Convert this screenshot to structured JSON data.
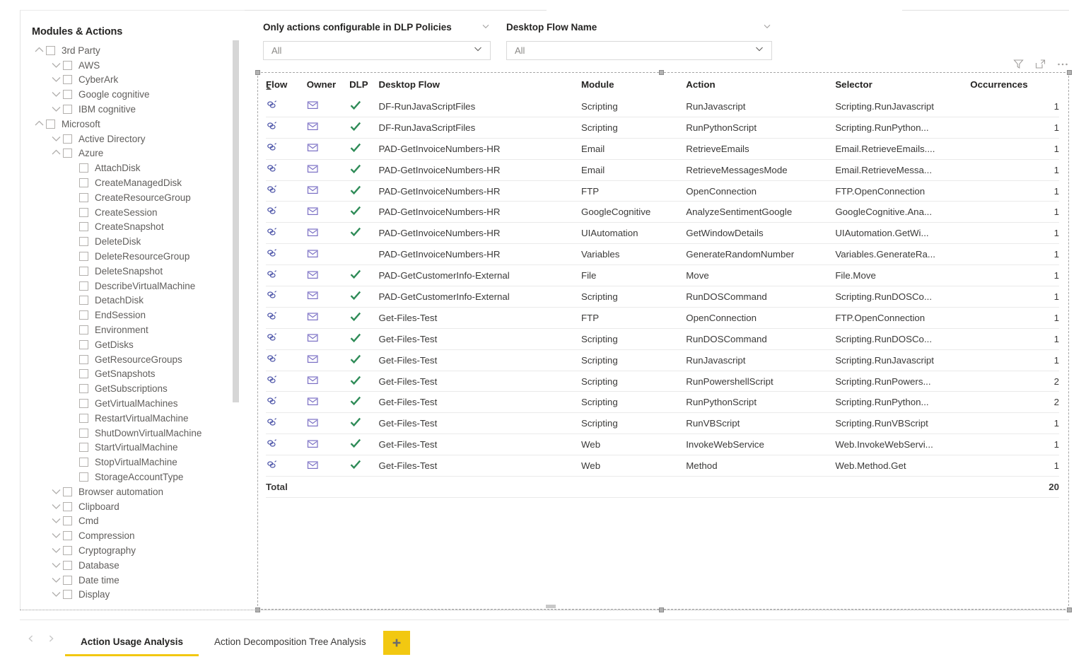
{
  "tree": {
    "title": "Modules & Actions",
    "items": [
      {
        "label": "3rd Party",
        "level": 0,
        "chevron": "up",
        "checkbox": true
      },
      {
        "label": "AWS",
        "level": 1,
        "chevron": "down",
        "checkbox": true
      },
      {
        "label": "CyberArk",
        "level": 1,
        "chevron": "down",
        "checkbox": true
      },
      {
        "label": "Google cognitive",
        "level": 1,
        "chevron": "down",
        "checkbox": true
      },
      {
        "label": "IBM cognitive",
        "level": 1,
        "chevron": "down",
        "checkbox": true
      },
      {
        "label": "Microsoft",
        "level": 0,
        "chevron": "up",
        "checkbox": true
      },
      {
        "label": "Active Directory",
        "level": 1,
        "chevron": "down",
        "checkbox": true
      },
      {
        "label": "Azure",
        "level": 1,
        "chevron": "up",
        "checkbox": true
      },
      {
        "label": "AttachDisk",
        "level": 2,
        "chevron": "none",
        "checkbox": true
      },
      {
        "label": "CreateManagedDisk",
        "level": 2,
        "chevron": "none",
        "checkbox": true
      },
      {
        "label": "CreateResourceGroup",
        "level": 2,
        "chevron": "none",
        "checkbox": true
      },
      {
        "label": "CreateSession",
        "level": 2,
        "chevron": "none",
        "checkbox": true
      },
      {
        "label": "CreateSnapshot",
        "level": 2,
        "chevron": "none",
        "checkbox": true
      },
      {
        "label": "DeleteDisk",
        "level": 2,
        "chevron": "none",
        "checkbox": true
      },
      {
        "label": "DeleteResourceGroup",
        "level": 2,
        "chevron": "none",
        "checkbox": true
      },
      {
        "label": "DeleteSnapshot",
        "level": 2,
        "chevron": "none",
        "checkbox": true
      },
      {
        "label": "DescribeVirtualMachine",
        "level": 2,
        "chevron": "none",
        "checkbox": true
      },
      {
        "label": "DetachDisk",
        "level": 2,
        "chevron": "none",
        "checkbox": true
      },
      {
        "label": "EndSession",
        "level": 2,
        "chevron": "none",
        "checkbox": true
      },
      {
        "label": "Environment",
        "level": 2,
        "chevron": "none",
        "checkbox": true
      },
      {
        "label": "GetDisks",
        "level": 2,
        "chevron": "none",
        "checkbox": true
      },
      {
        "label": "GetResourceGroups",
        "level": 2,
        "chevron": "none",
        "checkbox": true
      },
      {
        "label": "GetSnapshots",
        "level": 2,
        "chevron": "none",
        "checkbox": true
      },
      {
        "label": "GetSubscriptions",
        "level": 2,
        "chevron": "none",
        "checkbox": true
      },
      {
        "label": "GetVirtualMachines",
        "level": 2,
        "chevron": "none",
        "checkbox": true
      },
      {
        "label": "RestartVirtualMachine",
        "level": 2,
        "chevron": "none",
        "checkbox": true
      },
      {
        "label": "ShutDownVirtualMachine",
        "level": 2,
        "chevron": "none",
        "checkbox": true
      },
      {
        "label": "StartVirtualMachine",
        "level": 2,
        "chevron": "none",
        "checkbox": true
      },
      {
        "label": "StopVirtualMachine",
        "level": 2,
        "chevron": "none",
        "checkbox": true
      },
      {
        "label": "StorageAccountType",
        "level": 2,
        "chevron": "none",
        "checkbox": true
      },
      {
        "label": "Browser automation",
        "level": 1,
        "chevron": "down",
        "checkbox": true
      },
      {
        "label": "Clipboard",
        "level": 1,
        "chevron": "down",
        "checkbox": true
      },
      {
        "label": "Cmd",
        "level": 1,
        "chevron": "down",
        "checkbox": true
      },
      {
        "label": "Compression",
        "level": 1,
        "chevron": "down",
        "checkbox": true
      },
      {
        "label": "Cryptography",
        "level": 1,
        "chevron": "down",
        "checkbox": true
      },
      {
        "label": "Database",
        "level": 1,
        "chevron": "down",
        "checkbox": true
      },
      {
        "label": "Date time",
        "level": 1,
        "chevron": "down",
        "checkbox": true
      },
      {
        "label": "Display",
        "level": 1,
        "chevron": "down",
        "checkbox": true
      }
    ]
  },
  "slicers": [
    {
      "title": "Only actions configurable in DLP Policies",
      "value": "All"
    },
    {
      "title": "Desktop Flow Name",
      "value": "All"
    }
  ],
  "visual_header": {
    "filter_icon": "filter-icon",
    "focus_icon": "focus-mode-icon",
    "more_icon": "more-options-icon"
  },
  "table": {
    "columns": [
      "Flow",
      "Owner",
      "DLP",
      "Desktop Flow",
      "Module",
      "Action",
      "Selector",
      "Occurrences"
    ],
    "sorted_column": "Flow",
    "sort_direction": "asc",
    "icons": {
      "flow": "link-icon",
      "owner": "envelope-icon",
      "dlp": "checkmark-icon"
    },
    "rows": [
      {
        "flow": "link-icon",
        "owner": "envelope-icon",
        "dlp": true,
        "name": "DF-RunJavaScriptFiles",
        "module": "Scripting",
        "action": "RunJavascript",
        "selector": "Scripting.RunJavascript",
        "occurrences": "1"
      },
      {
        "flow": "link-icon",
        "owner": "envelope-icon",
        "dlp": true,
        "name": "DF-RunJavaScriptFiles",
        "module": "Scripting",
        "action": "RunPythonScript",
        "selector": "Scripting.RunPython...",
        "occurrences": "1"
      },
      {
        "flow": "link-icon",
        "owner": "envelope-icon",
        "dlp": true,
        "name": "PAD-GetInvoiceNumbers-HR",
        "module": "Email",
        "action": "RetrieveEmails",
        "selector": "Email.RetrieveEmails....",
        "occurrences": "1"
      },
      {
        "flow": "link-icon",
        "owner": "envelope-icon",
        "dlp": true,
        "name": "PAD-GetInvoiceNumbers-HR",
        "module": "Email",
        "action": "RetrieveMessagesMode",
        "selector": "Email.RetrieveMessa...",
        "occurrences": "1"
      },
      {
        "flow": "link-icon",
        "owner": "envelope-icon",
        "dlp": true,
        "name": "PAD-GetInvoiceNumbers-HR",
        "module": "FTP",
        "action": "OpenConnection",
        "selector": "FTP.OpenConnection",
        "occurrences": "1"
      },
      {
        "flow": "link-icon",
        "owner": "envelope-icon",
        "dlp": true,
        "name": "PAD-GetInvoiceNumbers-HR",
        "module": "GoogleCognitive",
        "action": "AnalyzeSentimentGoogle",
        "selector": "GoogleCognitive.Ana...",
        "occurrences": "1"
      },
      {
        "flow": "link-icon",
        "owner": "envelope-icon",
        "dlp": true,
        "name": "PAD-GetInvoiceNumbers-HR",
        "module": "UIAutomation",
        "action": "GetWindowDetails",
        "selector": "UIAutomation.GetWi...",
        "occurrences": "1"
      },
      {
        "flow": "link-icon",
        "owner": "envelope-icon",
        "dlp": false,
        "name": "PAD-GetInvoiceNumbers-HR",
        "module": "Variables",
        "action": "GenerateRandomNumber",
        "selector": "Variables.GenerateRa...",
        "occurrences": "1"
      },
      {
        "flow": "link-icon",
        "owner": "envelope-icon",
        "dlp": true,
        "name": "PAD-GetCustomerInfo-External",
        "module": "File",
        "action": "Move",
        "selector": "File.Move",
        "occurrences": "1"
      },
      {
        "flow": "link-icon",
        "owner": "envelope-icon",
        "dlp": true,
        "name": "PAD-GetCustomerInfo-External",
        "module": "Scripting",
        "action": "RunDOSCommand",
        "selector": "Scripting.RunDOSCo...",
        "occurrences": "1"
      },
      {
        "flow": "link-icon",
        "owner": "envelope-icon",
        "dlp": true,
        "name": "Get-Files-Test",
        "module": "FTP",
        "action": "OpenConnection",
        "selector": "FTP.OpenConnection",
        "occurrences": "1"
      },
      {
        "flow": "link-icon",
        "owner": "envelope-icon",
        "dlp": true,
        "name": "Get-Files-Test",
        "module": "Scripting",
        "action": "RunDOSCommand",
        "selector": "Scripting.RunDOSCo...",
        "occurrences": "1"
      },
      {
        "flow": "link-icon",
        "owner": "envelope-icon",
        "dlp": true,
        "name": "Get-Files-Test",
        "module": "Scripting",
        "action": "RunJavascript",
        "selector": "Scripting.RunJavascript",
        "occurrences": "1"
      },
      {
        "flow": "link-icon",
        "owner": "envelope-icon",
        "dlp": true,
        "name": "Get-Files-Test",
        "module": "Scripting",
        "action": "RunPowershellScript",
        "selector": "Scripting.RunPowers...",
        "occurrences": "2"
      },
      {
        "flow": "link-icon",
        "owner": "envelope-icon",
        "dlp": true,
        "name": "Get-Files-Test",
        "module": "Scripting",
        "action": "RunPythonScript",
        "selector": "Scripting.RunPython...",
        "occurrences": "2"
      },
      {
        "flow": "link-icon",
        "owner": "envelope-icon",
        "dlp": true,
        "name": "Get-Files-Test",
        "module": "Scripting",
        "action": "RunVBScript",
        "selector": "Scripting.RunVBScript",
        "occurrences": "1"
      },
      {
        "flow": "link-icon",
        "owner": "envelope-icon",
        "dlp": true,
        "name": "Get-Files-Test",
        "module": "Web",
        "action": "InvokeWebService",
        "selector": "Web.InvokeWebServi...",
        "occurrences": "1"
      },
      {
        "flow": "link-icon",
        "owner": "envelope-icon",
        "dlp": true,
        "name": "Get-Files-Test",
        "module": "Web",
        "action": "Method",
        "selector": "Web.Method.Get",
        "occurrences": "1"
      }
    ],
    "total": {
      "label": "Total",
      "occurrences": "20"
    }
  },
  "tabs": {
    "prev_icon": "chevron-left-icon",
    "next_icon": "chevron-right-icon",
    "items": [
      {
        "label": "Action Usage Analysis",
        "active": true
      },
      {
        "label": "Action Decomposition Tree Analysis",
        "active": false
      }
    ],
    "add_label": "+"
  },
  "colors": {
    "accent": "#f2c811",
    "dlp_check": "#2e8b57",
    "flow_icon": "#4b53a8",
    "owner_icon": "#6a5acd",
    "text": "#252423",
    "muted": "#605e5c"
  }
}
